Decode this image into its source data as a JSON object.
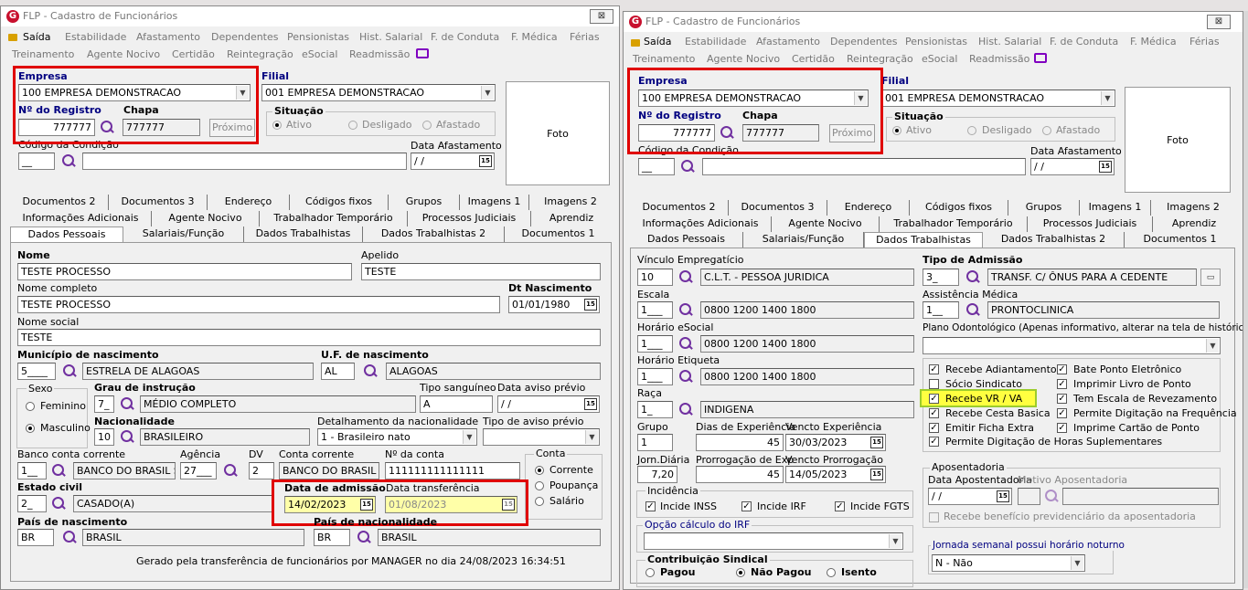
{
  "window_title": "FLP - Cadastro de Funcionários",
  "close_glyph": "⊠",
  "menu": {
    "row1": [
      "Saída",
      "Estabilidade",
      "Afastamento",
      "Dependentes",
      "Pensionistas",
      "Hist. Salarial",
      "F. de Conduta",
      "F. Médica",
      "Férias"
    ],
    "row2": [
      "Treinamento",
      "Agente Nocivo",
      "Certidão",
      "Reintegração",
      "eSocial",
      "Readmissão"
    ]
  },
  "header": {
    "empresa_label": "Empresa",
    "empresa_value": "100 EMPRESA DEMONSTRACAO",
    "filial_label": "Filial",
    "filial_value": "001 EMPRESA DEMONSTRACAO",
    "registro_label": "Nº do Registro",
    "registro_value": "777777",
    "chapa_label": "Chapa",
    "chapa_value": "777777",
    "proximo": "Próximo",
    "situacao_label": "Situação",
    "sit_ativo": "Ativo",
    "sit_desligado": "Desligado",
    "sit_afastado": "Afastado",
    "foto": "Foto",
    "condicao_label": "Código da Condição",
    "condicao_value": "__",
    "data_afast_label": "Data Afastamento",
    "data_afast_value": "/  /"
  },
  "tabs": {
    "row1": [
      "Documentos 2",
      "Documentos 3",
      "Endereço",
      "Códigos fixos",
      "Grupos",
      "Imagens 1",
      "Imagens 2"
    ],
    "row2": [
      "Informações Adicionais",
      "Agente Nocivo",
      "Trabalhador Temporário",
      "Processos Judiciais",
      "Aprendiz"
    ],
    "row3": [
      "Dados Pessoais",
      "Salariais/Função",
      "Dados Trabalhistas",
      "Dados Trabalhistas 2",
      "Documentos 1"
    ]
  },
  "pessoais": {
    "nome_label": "Nome",
    "nome": "TESTE PROCESSO",
    "apelido_label": "Apelido",
    "apelido": "TESTE",
    "nome_completo_label": "Nome completo",
    "nome_completo": "TESTE PROCESSO",
    "dt_nasc_label": "Dt Nascimento",
    "dt_nasc": "01/01/1980",
    "nome_social_label": "Nome social",
    "nome_social": "TESTE",
    "mun_label": "Município de nascimento",
    "mun_code": "5____",
    "mun_name": "ESTRELA DE ALAGOAS",
    "uf_label": "U.F. de nascimento",
    "uf_code": "AL",
    "uf_name": "ALAGOAS",
    "sexo_label": "Sexo",
    "sexo_f": "Feminino",
    "sexo_m": "Masculino",
    "grau_label": "Grau de instrução",
    "grau_code": "7_",
    "grau_name": "MÉDIO COMPLETO",
    "tipo_sang_label": "Tipo sanguíneo",
    "tipo_sang": "A",
    "aviso_label": "Data aviso prévio",
    "aviso": "/  /",
    "nac_label": "Nacionalidade",
    "nac_code": "10",
    "nac_name": "BRASILEIRO",
    "det_nac_label": "Detalhamento da nacionalidade",
    "det_nac": "1 - Brasileiro nato",
    "tipo_aviso_label": "Tipo de aviso prévio",
    "tipo_aviso": "",
    "banco_label": "Banco conta corrente",
    "banco_code": "1__",
    "banco_name": "BANCO DO BRASIL S",
    "agencia_label": "Agência",
    "agencia": "27___",
    "dv_label": "DV",
    "dv": "2",
    "conta_label": "Conta corrente",
    "conta_banco": "BANCO DO BRASIL /",
    "nconta_label": "Nº da conta",
    "nconta": "111111111111111",
    "conta_group": "Conta",
    "conta_corrente": "Corrente",
    "conta_poupanca": "Poupança",
    "conta_salario": "Salário",
    "civil_label": "Estado civil",
    "civil_code": "2_",
    "civil_name": "CASADO(A)",
    "admissao_label": "Data de admissão",
    "admissao": "14/02/2023",
    "transf_label": "Data transferência",
    "transf": "01/08/2023",
    "pais_label": "País de nascimento",
    "pais_code": "BR",
    "pais_name": "BRASIL",
    "pais_nac_label": "País de nacionalidade",
    "pais_nac_code": "BR",
    "pais_nac_name": "BRASIL",
    "footer": "Gerado pela transferência de funcionários por MANAGER no dia 24/08/2023 16:34:51"
  },
  "trabalhistas": {
    "vinculo_label": "Vínculo Empregatício",
    "vinculo_code": "10",
    "vinculo_name": "C.L.T. - PESSOA JURIDICA",
    "tipo_adm_label": "Tipo de Admissão",
    "tipo_adm_code": "3_",
    "tipo_adm_name": "TRANSF. C/ ÔNUS PARA A CEDENTE",
    "escala_label": "Escala",
    "escala_code": "1___",
    "escala_name": "0800 1200 1400 1800",
    "assist_label": "Assistência Médica",
    "assist_code": "1__",
    "assist_name": "PRONTOCLINICA",
    "horario_esocial_label": "Horário eSocial",
    "horario_esocial_code": "1___",
    "horario_esocial_name": "0800 1200 1400 1800",
    "odonto_label": "Plano Odontológico (Apenas informativo, alterar na tela de histórico)",
    "odonto": "",
    "horario_etiq_label": "Horário Etiqueta",
    "horario_etiq_code": "1___",
    "horario_etiq_name": "0800 1200 1400 1800",
    "raca_label": "Raça",
    "raca_code": "1_",
    "raca_name": "INDIGENA",
    "grupo_label": "Grupo",
    "grupo": "1",
    "dias_exp_label": "Dias de Experiência",
    "dias_exp": "45",
    "vencto_exp_label": "Vencto Experiência",
    "vencto_exp": "30/03/2023",
    "jorn_label": "Jorn.Diária",
    "jorn": "7,20",
    "prorrog_label": "Prorrogação de Exp",
    "prorrog": "45",
    "vencto_prorrog_label": "Vencto Prorrogação",
    "vencto_prorrog": "14/05/2023",
    "checks_left": [
      "Recebe Adiantamento",
      "Sócio Sindicato",
      "Recebe VR / VA",
      "Recebe Cesta Basica",
      "Emitir Ficha Extra",
      "Permite Digitação de Horas Suplementares"
    ],
    "checks_right": [
      "Bate Ponto Eletrônico",
      "Imprimir Livro de Ponto",
      "Tem Escala de Revezamento",
      "Permite Digitação na Frequência",
      "Imprime Cartão de Ponto"
    ],
    "incid_label": "Incidência",
    "incid": [
      "Incide INSS",
      "Incide IRF",
      "Incide FGTS"
    ],
    "irf_label": "Opção cálculo do IRF",
    "irf": "",
    "contrib_label": "Contribuição Sindical",
    "contrib": [
      "Pagou",
      "Não Pagou",
      "Isento"
    ],
    "apos_label": "Aposentadoria",
    "apos_data_label": "Data Apostentadoria",
    "apos_data": "/  /",
    "apos_motivo_label": "Motivo Aposentadoria",
    "apos_beneficio": "Recebe benefício previdenciário da aposentadoria",
    "jornada_label": "Jornada semanal possui horário noturno",
    "jornada": "N - Não"
  },
  "colors": {
    "highlight_red": "#e00000",
    "highlight_yellow": "#ffff40",
    "field_yellow": "#ffffa8",
    "logo": "#c8102e",
    "label_navy": "#000080"
  }
}
